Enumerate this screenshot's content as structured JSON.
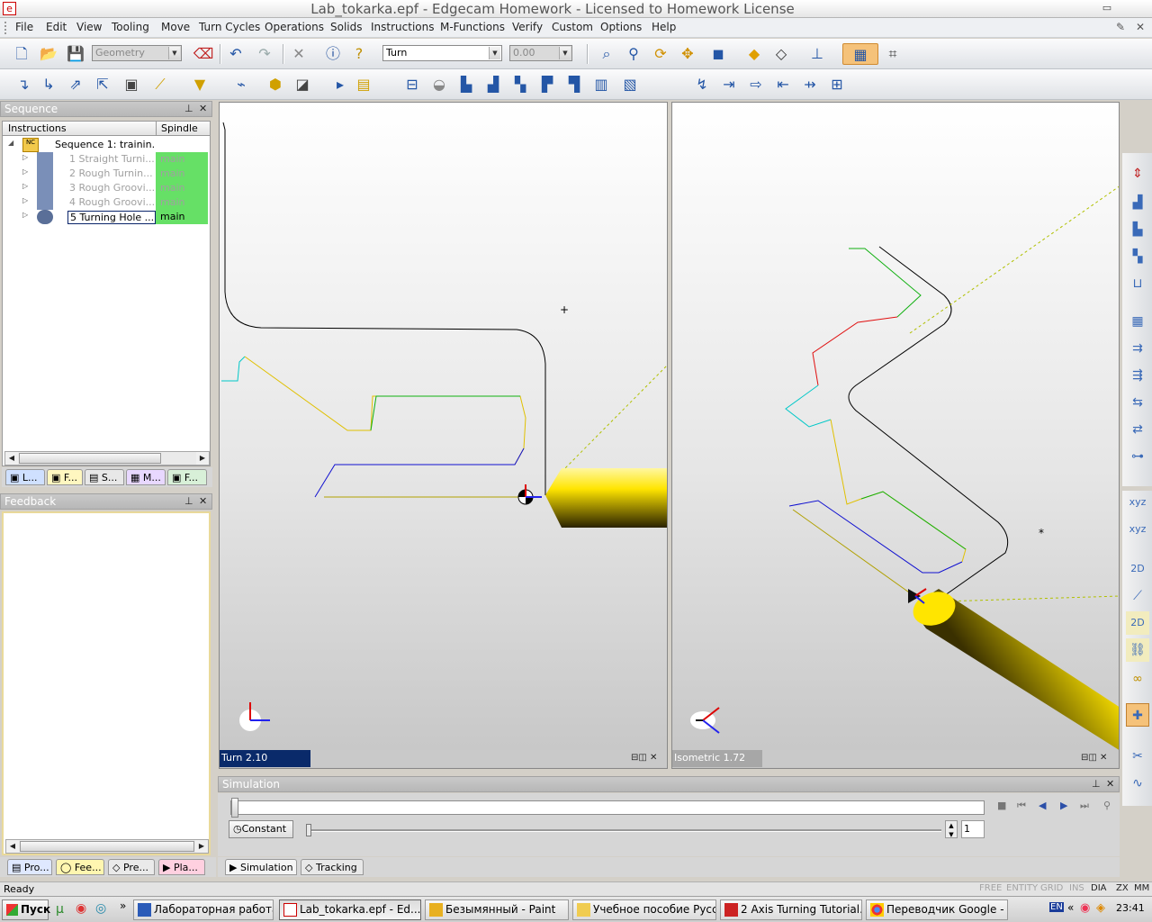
{
  "window": {
    "title": "Lab_tokarka.epf - Edgecam Homework - Licensed to Homework License",
    "app_icon": "e"
  },
  "menu": [
    "File",
    "Edit",
    "View",
    "Tooling",
    "Move",
    "Turn Cycles",
    "Operations",
    "Instructions",
    "M-Functions",
    "Solids",
    "Instructions",
    "Verify",
    "Custom",
    "Options",
    "Help"
  ],
  "menu_items": {
    "file": "File",
    "edit": "Edit",
    "view": "View",
    "tooling": "Tooling",
    "move": "Move",
    "turn_cycles": "Turn Cycles",
    "operations": "Operations",
    "instructions": "Instructions",
    "m_functions": "M-Functions",
    "solids": "Solids",
    "verify": "Verify",
    "custom": "Custom",
    "options": "Options",
    "help": "Help"
  },
  "toolbar": {
    "geometry_combo": "Geometry",
    "mode_combo": "Turn",
    "value_combo": "0.00"
  },
  "sequence": {
    "title": "Sequence",
    "col_instructions": "Instructions",
    "col_spindle": "Spindle",
    "root": "Sequence 1: trainin...",
    "items": [
      {
        "label": "1 Straight Turni...",
        "spindle": "main",
        "active": false
      },
      {
        "label": "2 Rough Turnin...",
        "spindle": "main",
        "active": false
      },
      {
        "label": "3 Rough Groovi...",
        "spindle": "main",
        "active": false
      },
      {
        "label": "4 Rough Groovi...",
        "spindle": "main",
        "active": false
      },
      {
        "label": "5 Turning Hole ...",
        "spindle": "main",
        "active": true
      }
    ],
    "tabs": [
      "L...",
      "F...",
      "S...",
      "M...",
      "F..."
    ]
  },
  "feedback": {
    "title": "Feedback"
  },
  "left_bottom_tabs": [
    "Pro...",
    "Fee...",
    "Pre...",
    "Pla..."
  ],
  "viewports": {
    "left": {
      "label": "Turn 2.10"
    },
    "right": {
      "label": "Isometric 1.72"
    }
  },
  "simulation": {
    "title": "Simulation",
    "constant_label": "Constant",
    "speed_value": "1",
    "tabs": [
      "Simulation",
      "Tracking"
    ]
  },
  "status": {
    "text": "Ready",
    "indicators": [
      "FREE",
      "ENTITY",
      "GRID",
      "INS",
      "DIA",
      "ZX",
      "MM"
    ],
    "active_indicators": [
      "DIA",
      "ZX",
      "MM"
    ]
  },
  "taskbar": {
    "start": "Пуск",
    "tasks": [
      {
        "label": "Лабораторная работа...",
        "active": false
      },
      {
        "label": "Lab_tokarka.epf - Ed...",
        "active": true
      },
      {
        "label": "Безымянный - Paint",
        "active": false
      },
      {
        "label": "Учебное пособие Русское",
        "active": false
      },
      {
        "label": "2 Axis Turning Tutorial.p...",
        "active": false
      },
      {
        "label": "Переводчик Google - G...",
        "active": false
      }
    ],
    "lang": "EN",
    "clock": "23:41"
  },
  "colors": {
    "spindle_green": "#66e066",
    "tool_yellow": "#f0d000",
    "vp_label_bg": "#0a2a6a"
  }
}
